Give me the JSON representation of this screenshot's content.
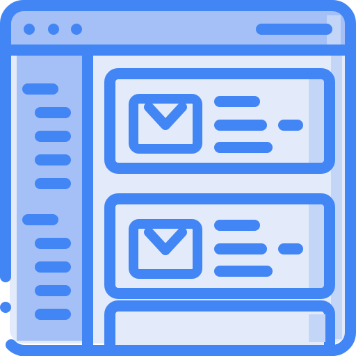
{
  "icon": "email-client-window-icon",
  "window": {
    "titlebar": {
      "controls": [
        "window-dot",
        "window-dot",
        "window-dot"
      ],
      "address_bar": "address-bar-pill"
    },
    "sidebar": {
      "groups": [
        {
          "header": "sidebar-heading-line",
          "items": [
            "sidebar-line",
            "sidebar-line",
            "sidebar-line",
            "sidebar-line"
          ]
        },
        {
          "header": "sidebar-heading-line",
          "items": [
            "sidebar-line",
            "sidebar-line",
            "sidebar-line",
            "sidebar-line"
          ]
        }
      ]
    },
    "messages": [
      {
        "icon": "envelope-icon",
        "lines": 3,
        "tag": "badge-pill"
      },
      {
        "icon": "envelope-icon",
        "lines": 3,
        "tag": "badge-pill"
      },
      {
        "icon": "envelope-icon",
        "lines": 0,
        "tag": ""
      }
    ]
  },
  "colors": {
    "stroke": "#4285F4",
    "window_fill": "#E3EBFA",
    "sidebar_fill": "#A4C0F6",
    "titlebar_fill": "#A4C0F6",
    "card_fill": "#E3EBFA",
    "card_shade": "#C4D6F8",
    "envelope_fill": "#E3EBFA"
  }
}
